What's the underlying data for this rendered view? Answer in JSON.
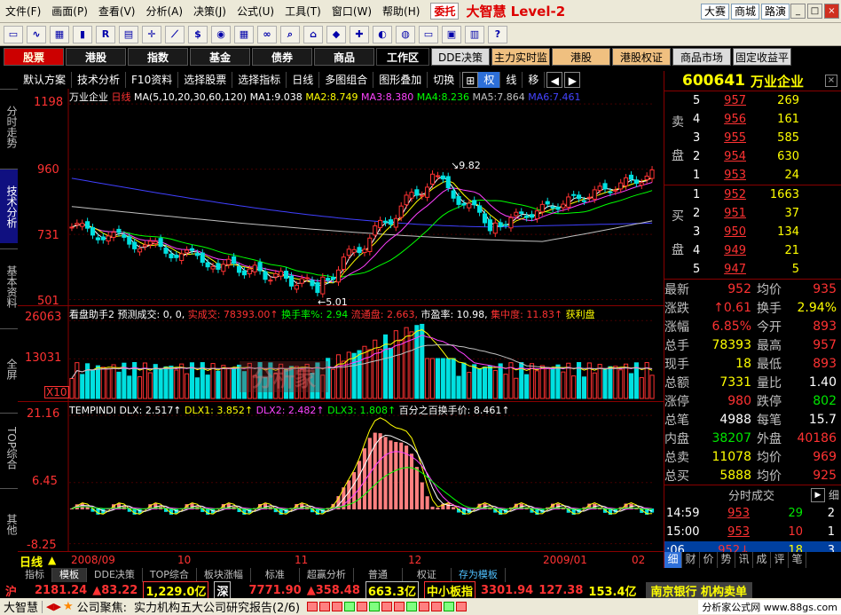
{
  "menu": {
    "items": [
      "文件(F)",
      "画面(P)",
      "查看(V)",
      "分析(A)",
      "决策(J)",
      "公式(U)",
      "工具(T)",
      "窗口(W)",
      "帮助(H)"
    ],
    "advert": "委托",
    "brand": "大智慧 Level-2",
    "right_buttons": [
      "大赛",
      "商城",
      "路演"
    ]
  },
  "categories": {
    "items": [
      "股票",
      "港股",
      "指数",
      "基金",
      "债券",
      "商品"
    ],
    "workspace": "工作区",
    "dde": [
      "DDE决策",
      "主力实时监控",
      "港股",
      "港股权证",
      "商品市场",
      "固定收益平台"
    ]
  },
  "subbar": {
    "items": [
      "默认方案",
      "技术分析",
      "F10资料",
      "选择股票",
      "选择指标",
      "日线",
      "多图组合",
      "图形叠加",
      "切换",
      "权",
      "线",
      "移"
    ]
  },
  "lefttabs": [
    "分时走势",
    "技术分析",
    "基本资料",
    "全屏",
    "TOP综合",
    "其他"
  ],
  "main_chart": {
    "title": "万业企业",
    "period": "日线",
    "ma_label": "MA(5,10,20,30,60,120)",
    "ma_values": [
      {
        "name": "MA1:",
        "value": "9.038",
        "color": "#ffffff"
      },
      {
        "name": "MA2:",
        "value": "8.749",
        "color": "#ffff00"
      },
      {
        "name": "MA3:",
        "value": "8.380",
        "color": "#ff40ff"
      },
      {
        "name": "MA4:",
        "value": "8.236",
        "color": "#00ff00"
      },
      {
        "name": "MA5:",
        "value": "7.864",
        "color": "#c0c0c0"
      },
      {
        "name": "MA6:",
        "value": "7.461",
        "color": "#4040ff"
      }
    ],
    "y_ticks": [
      "1198",
      "960",
      "731",
      "501"
    ],
    "hi_label": "9.82",
    "lo_label": "5.01"
  },
  "volume_chart": {
    "title": "看盘助手2",
    "items": [
      {
        "text": "预测成交: 0, 0,",
        "color": "#ffffff"
      },
      {
        "text": "实成交: 78393.00↑",
        "color": "#ff3232"
      },
      {
        "text": "换手率%: 2.94",
        "color": "#00ff00"
      },
      {
        "text": "流通盘: 2.663,",
        "color": "#ff3232"
      },
      {
        "text": "市盈率: 10.98,",
        "color": "#ffffff"
      },
      {
        "text": "集中度: 11.83↑",
        "color": "#ff3232"
      },
      {
        "text": "获利盘",
        "color": "#ffff00"
      }
    ],
    "y_ticks": [
      "26063",
      "13031"
    ],
    "mult": "X10",
    "watermark": "分析家"
  },
  "ind_chart": {
    "title": "TEMPINDI",
    "items": [
      {
        "text": "DLX: 2.517↑",
        "color": "#ffffff"
      },
      {
        "text": "DLX1: 3.852↑",
        "color": "#ffff00"
      },
      {
        "text": "DLX2: 2.482↑",
        "color": "#ff40ff"
      },
      {
        "text": "DLX3: 1.808↑",
        "color": "#00ff00"
      },
      {
        "text": "百分之百换手价: 8.461↑",
        "color": "#ffffff"
      }
    ],
    "y_ticks": [
      "21.16",
      "6.45",
      "-8.25"
    ]
  },
  "xaxis": {
    "period_label": "日线",
    "labels": [
      "2008/09",
      "10",
      "11",
      "12",
      "2009/01",
      "02"
    ]
  },
  "rightpanel": {
    "code": "600641",
    "name": "万业企业",
    "sell_label": [
      "卖",
      "盘"
    ],
    "buy_label": [
      "买",
      "盘"
    ],
    "sells": [
      {
        "lv": "5",
        "px": "957",
        "vol": "269"
      },
      {
        "lv": "4",
        "px": "956",
        "vol": "161"
      },
      {
        "lv": "3",
        "px": "955",
        "vol": "585"
      },
      {
        "lv": "2",
        "px": "954",
        "vol": "630"
      },
      {
        "lv": "1",
        "px": "953",
        "vol": "24"
      }
    ],
    "buys": [
      {
        "lv": "1",
        "px": "952",
        "vol": "1663"
      },
      {
        "lv": "2",
        "px": "951",
        "vol": "37"
      },
      {
        "lv": "3",
        "px": "950",
        "vol": "134"
      },
      {
        "lv": "4",
        "px": "949",
        "vol": "21"
      },
      {
        "lv": "5",
        "px": "947",
        "vol": "5"
      }
    ],
    "quotes": [
      {
        "k": "最新",
        "v": "952",
        "vc": "red",
        "k2": "均价",
        "v2": "935",
        "v2c": "red"
      },
      {
        "k": "涨跌",
        "v": "↑0.61",
        "vc": "red",
        "k2": "换手",
        "v2": "2.94%",
        "v2c": "yel"
      },
      {
        "k": "涨幅",
        "v": "6.85%",
        "vc": "red",
        "k2": "今开",
        "v2": "893",
        "v2c": "red"
      },
      {
        "k": "总手",
        "v": "78393",
        "vc": "yel",
        "k2": "最高",
        "v2": "957",
        "v2c": "red"
      },
      {
        "k": "现手",
        "v": "18",
        "vc": "yel",
        "k2": "最低",
        "v2": "893",
        "v2c": "red"
      },
      {
        "k": "总额",
        "v": "7331",
        "vc": "yel",
        "k2": "量比",
        "v2": "1.40",
        "v2c": "wht"
      },
      {
        "k": "涨停",
        "v": "980",
        "vc": "red",
        "k2": "跌停",
        "v2": "802",
        "v2c": "grn"
      },
      {
        "k": "总笔",
        "v": "4988",
        "vc": "wht",
        "k2": "每笔",
        "v2": "15.7",
        "v2c": "wht"
      },
      {
        "k": "内盘",
        "v": "38207",
        "vc": "grn",
        "k2": "外盘",
        "v2": "40186",
        "v2c": "red"
      },
      {
        "k": "总卖",
        "v": "11078",
        "vc": "yel",
        "k2": "均价",
        "v2": "969",
        "v2c": "red"
      },
      {
        "k": "总买",
        "v": "5888",
        "vc": "yel",
        "k2": "均价",
        "v2": "925",
        "v2c": "red"
      }
    ],
    "trade_title": "分时成交",
    "trade_btn": "细",
    "trades": [
      {
        "t": "14:59",
        "p": "953",
        "v": "29",
        "vc": "grn",
        "n": "2"
      },
      {
        "t": "15:00",
        "p": "953",
        "v": "10",
        "vc": "red",
        "n": "1"
      },
      {
        "t": ":06",
        "p": "952↓",
        "v": "18",
        "vc": "yel",
        "n": "3"
      }
    ],
    "tabs": [
      "细",
      "财",
      "价",
      "势",
      "讯",
      "成",
      "评",
      "笔"
    ]
  },
  "bottomtabs": [
    "指标",
    "模板",
    "DDE决策",
    "TOP综合",
    "板块涨幅",
    "标准",
    "超赢分析",
    "普通",
    "权证",
    "存为模板"
  ],
  "indexstrip": {
    "sh_label": "沪",
    "sh_val": "2181.24",
    "sh_chg": "▲83.22",
    "sh_amt": "1,229.0亿",
    "sz_label": "深",
    "sz_val": "7771.90",
    "sz_chg": "▲358.48",
    "sz_amt": "663.3亿",
    "zx_label": "中小板指",
    "zx_val": "3301.94",
    "zx_chg": "127.38",
    "zx_amt": "153.4亿",
    "ticker": "南京银行 机构卖单"
  },
  "statusbar": {
    "app": "大智慧",
    "news": "公司聚焦:",
    "headline": "实力机构五大公司研究报告(2/6)",
    "site": "分析家公式网 www.88gs.com"
  }
}
